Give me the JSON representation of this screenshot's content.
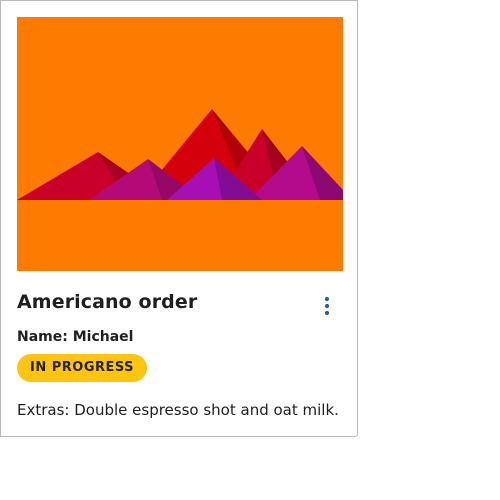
{
  "card": {
    "title": "Americano order",
    "name_line": "Name: Michael",
    "status_badge": "IN PROGRESS",
    "extras_line": "Extras: Double espresso shot and oat milk.",
    "menu_icon": "vertical-ellipsis-icon"
  },
  "image": {
    "description_icon": "mountains-illustration",
    "colors": {
      "background": "#ff7a00",
      "mountain_red": "#d3000a",
      "mountain_crimson": "#c4002c",
      "mountain_magenta": "#b40a8c",
      "mountain_purple": "#a60fb0"
    }
  },
  "colors": {
    "badge": "#fdc512",
    "menu_icon": "#2b5c9c",
    "border": "#b9b9b9"
  }
}
